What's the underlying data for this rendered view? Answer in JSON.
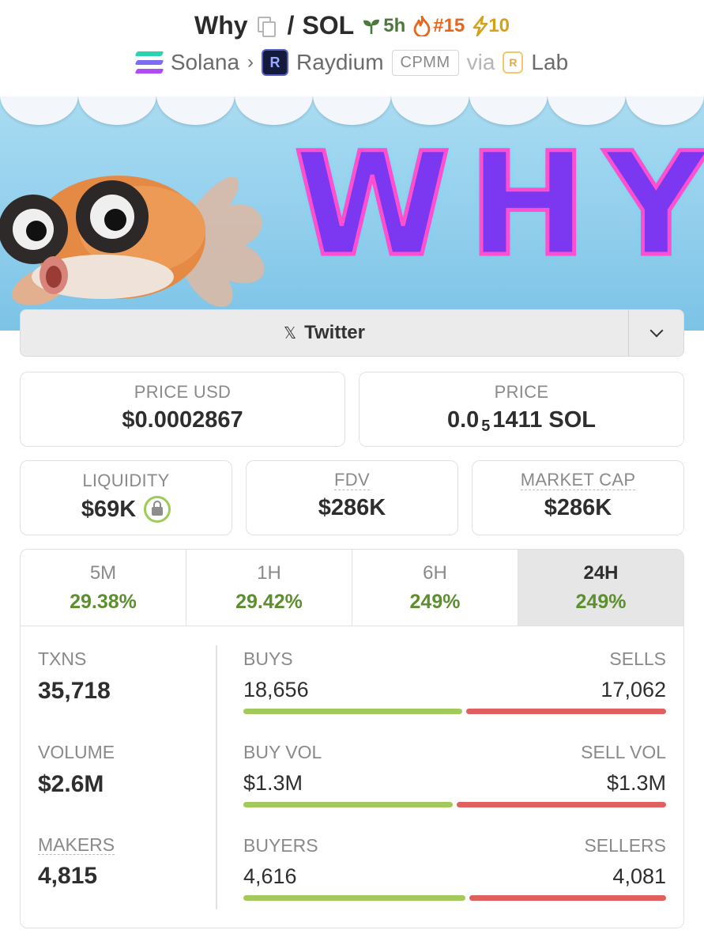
{
  "header": {
    "token_name": "Why",
    "separator": "/",
    "quote_symbol": "SOL",
    "age": "5h",
    "trending_rank": "#15",
    "boosts": "10",
    "chain": "Solana",
    "dex": "Raydium",
    "pool_type": "CPMM",
    "via": "via",
    "launchpad": "Lab"
  },
  "banner": {
    "text": "WHY"
  },
  "social": {
    "label": "Twitter",
    "x_glyph": "𝕏"
  },
  "prices": {
    "price_usd_label": "PRICE USD",
    "price_usd_value": "$0.0002867",
    "price_label": "PRICE",
    "price_prefix": "0.0",
    "price_zeros": "5",
    "price_suffix": "1411 SOL"
  },
  "metrics": {
    "liquidity_label": "LIQUIDITY",
    "liquidity_value": "$69K",
    "fdv_label": "FDV",
    "fdv_value": "$286K",
    "mcap_label": "MARKET CAP",
    "mcap_value": "$286K"
  },
  "timeframes": [
    {
      "label": "5M",
      "change": "29.38%"
    },
    {
      "label": "1H",
      "change": "29.42%"
    },
    {
      "label": "6H",
      "change": "249%"
    },
    {
      "label": "24H",
      "change": "249%"
    }
  ],
  "active_timeframe": "24H",
  "stats": {
    "txns_label": "TXNS",
    "txns_value": "35,718",
    "volume_label": "VOLUME",
    "volume_value": "$2.6M",
    "makers_label": "MAKERS",
    "makers_value": "4,815",
    "buys_label": "BUYS",
    "buys_value": "18,656",
    "sells_label": "SELLS",
    "sells_value": "17,062",
    "buy_vol_label": "BUY VOL",
    "buy_vol_value": "$1.3M",
    "sell_vol_label": "SELL VOL",
    "sell_vol_value": "$1.3M",
    "buyers_label": "BUYERS",
    "buyers_value": "4,616",
    "sellers_label": "SELLERS",
    "sellers_value": "4,081",
    "buy_share_txns": 0.522,
    "buy_share_volume": 0.5,
    "buy_share_makers": 0.531
  },
  "colors": {
    "positive": "#5d8f2f",
    "buy_bar": "#a3c95d",
    "sell_bar": "#e06060",
    "banner_text": "#7b38f0"
  }
}
